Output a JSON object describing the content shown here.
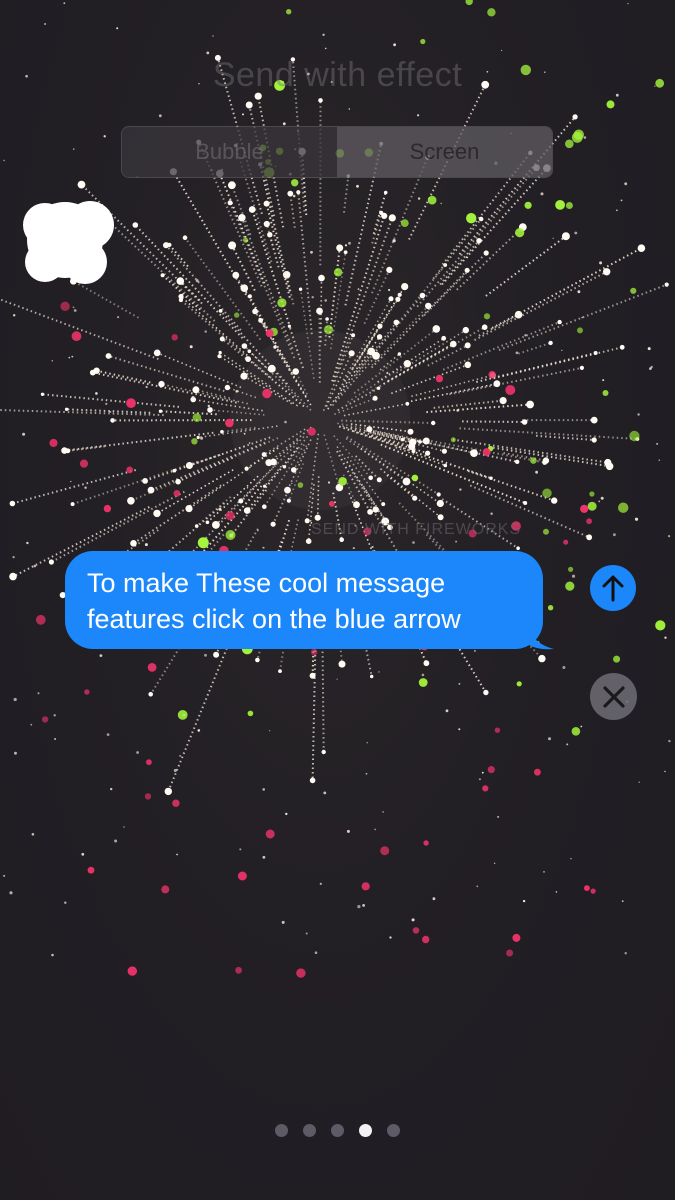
{
  "header": {
    "title": "Send with effect"
  },
  "tabs": [
    {
      "label": "Bubble",
      "selected": false
    },
    {
      "label": "Screen",
      "selected": true
    }
  ],
  "effect": {
    "label": "SEND WITH FIREWORKS"
  },
  "message": {
    "line1": "To make These cool message",
    "line2": "features click on the blue arrow"
  },
  "buttons": {
    "send_icon": "arrow-up-icon",
    "cancel_icon": "close-icon"
  },
  "pager": {
    "count": 5,
    "active_index": 3
  },
  "colors": {
    "accent": "#1b87fb",
    "background": "#221f26",
    "spark": "#f4e6d6",
    "green": "#a4f53c",
    "pink": "#f0336a"
  }
}
